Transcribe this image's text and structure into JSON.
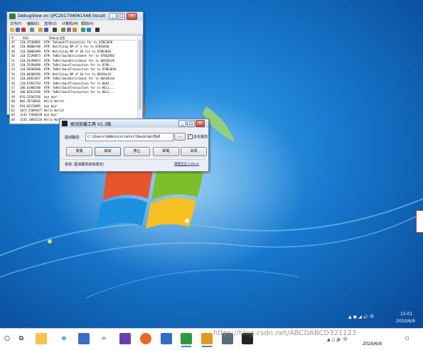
{
  "colors": {
    "desktop_blue": "#1a73c8",
    "title_active": "#c7d6ea",
    "accent": "#4a7fd6"
  },
  "debugview": {
    "title": "DebugView on \\\\PC201704061548 (local)",
    "menu": [
      "文件(F)",
      "编辑(E)",
      "选项(O)",
      "计算机(M)",
      "帮助(H)"
    ],
    "columns": [
      "#",
      "时间",
      "Debug 信息"
    ],
    "rows": [
      {
        "n": "47",
        "t": "110.47188891",
        "msg": "KTM:  TmCommitTransaction for tx 878E3850"
      },
      {
        "n": "48",
        "t": "110.48806788",
        "msg": "KTM:  Notifying RM of 4 for tx 878E3850"
      },
      {
        "n": "49",
        "t": "110.50801999",
        "msg": "KTM:  Notifying RM of 64 for tx 878E3850"
      },
      {
        "n": "50",
        "t": "110.51198873",
        "msg": "KTM:  TmRollbackEnlistment for tx 878E3850"
      },
      {
        "n": "51",
        "t": "110.54298874",
        "msg": "KTM:  TmRollbackEnlistment for tx 86A28e18"
      },
      {
        "n": "52",
        "t": "110.55596698",
        "msg": "KTM:  TmRollbackTransaction for tx 8799..."
      },
      {
        "n": "53",
        "t": "110.58368396",
        "msg": "KTM:  TmRollbackTransaction for tx 878E3850"
      },
      {
        "n": "54",
        "t": "110.60388196",
        "msg": "KTM:  Notifying RM of 64 for tx 86A28e18"
      },
      {
        "n": "55",
        "t": "110.64852837",
        "msg": "KTM:  TmRollbackEnlistment for tx 86A28e18"
      },
      {
        "n": "56",
        "t": "110.67852793",
        "msg": "KTM:  TmRollbackTransaction for tx 86A2..."
      },
      {
        "n": "57",
        "t": "206.61966780",
        "msg": "KTM:  TmRollbackTransaction for tx 86c1..."
      },
      {
        "n": "58",
        "t": "206.65813196",
        "msg": "KTM:  TmRollbackTransaction for tx 86c2..."
      },
      {
        "n": "59",
        "t": "876.53582746",
        "msg": "bye bye!"
      },
      {
        "n": "60",
        "t": "882.78710916",
        "msg": "Hello World!"
      },
      {
        "n": "61",
        "t": "916.02376895",
        "msg": "bye bye!"
      },
      {
        "n": "62",
        "t": "1072.55894477",
        "msg": "Hello World!"
      },
      {
        "n": "63",
        "t": "1143.73468328",
        "msg": "bye bye!"
      },
      {
        "n": "64",
        "t": "1156.18832224",
        "msg": "Hello World!"
      }
    ]
  },
  "loader": {
    "title": "驱动加载工具 V1.3版",
    "path_label": "驱动路径:",
    "path_value": "C:\\Users\\Administrator\\Desktop\\MyD",
    "browse_label": "...",
    "ontop_label": "总在最前",
    "ontop_checked": true,
    "buttons": [
      "安装",
      "启动",
      "停止",
      "卸载",
      "关闭"
    ],
    "status": "状态: 驱动服务启动成功!",
    "link": "耀耀出品 Cobras"
  },
  "taskbar": {
    "clock_time": "15:01",
    "clock_date": "2020/6/9",
    "watermark": "https://blog.csdn.net/ABCDABCD321123",
    "apps": [
      "task-view",
      "file-explorer",
      "edge",
      "store",
      "visual-studio",
      "firefox",
      "app-blue",
      "app-green",
      "app-orange",
      "app-gray",
      "explorer-2"
    ]
  }
}
